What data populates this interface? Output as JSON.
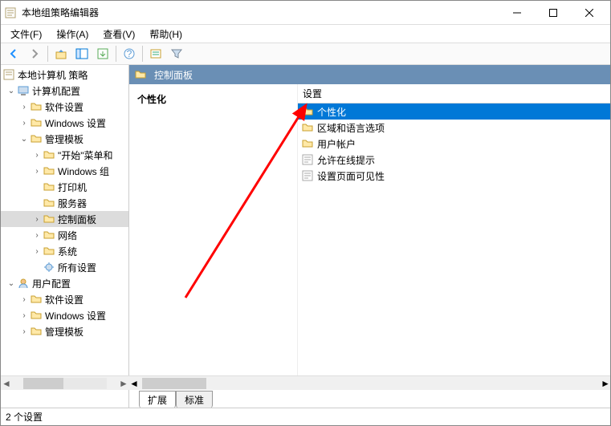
{
  "window": {
    "title": "本地组策略编辑器"
  },
  "menu": {
    "file": "文件(F)",
    "action": "操作(A)",
    "view": "查看(V)",
    "help": "帮助(H)"
  },
  "tree": {
    "root": "本地计算机 策略",
    "computer_cfg": "计算机配置",
    "software": "软件设置",
    "windows_settings": "Windows 设置",
    "admin_templates": "管理模板",
    "start_menu": "\"开始\"菜单和",
    "windows_components": "Windows 组",
    "printers": "打印机",
    "servers": "服务器",
    "control_panel": "控制面板",
    "network": "网络",
    "system": "系统",
    "all_settings": "所有设置",
    "user_cfg": "用户配置",
    "u_software": "软件设置",
    "u_windows": "Windows 设置",
    "u_admin": "管理模板"
  },
  "detail": {
    "header": "控制面板",
    "left_title": "个性化",
    "col_setting": "设置",
    "items": {
      "personalization": "个性化",
      "region_lang": "区域和语言选项",
      "user_accounts": "用户帐户",
      "online_tips": "允许在线提示",
      "page_visibility": "设置页面可见性"
    }
  },
  "tabs": {
    "extended": "扩展",
    "standard": "标准"
  },
  "status": {
    "count": "2 个设置"
  }
}
